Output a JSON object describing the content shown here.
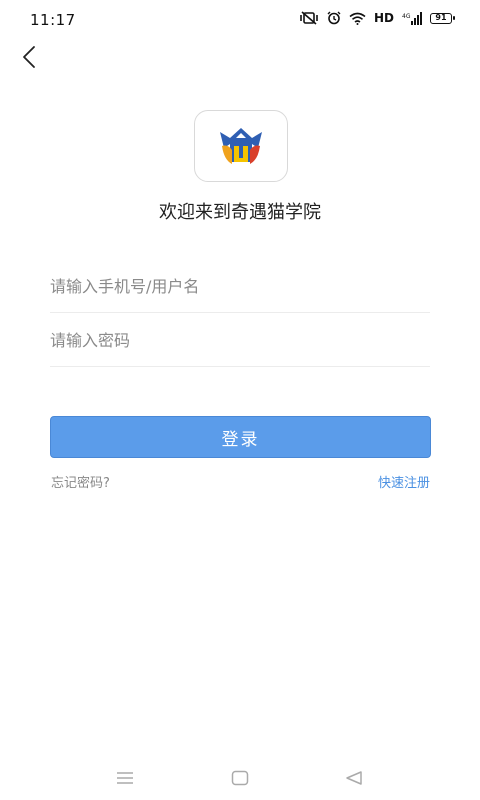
{
  "status_bar": {
    "time": "11:17",
    "network": "HD",
    "battery": "91"
  },
  "header": {
    "back_icon": "chevron-left-icon"
  },
  "logo": {
    "icon": "owl-logo-icon",
    "colors": {
      "blue": "#2f5fb3",
      "orange": "#f0a21c",
      "red": "#d9402b"
    }
  },
  "welcome_text": "欢迎来到奇遇猫学院",
  "form": {
    "username_placeholder": "请输入手机号/用户名",
    "password_placeholder": "请输入密码",
    "login_label": "登录",
    "forgot_label": "忘记密码?",
    "register_label": "快速注册"
  },
  "colors": {
    "accent": "#5b9cea",
    "link": "#4a90e2"
  },
  "nav_bar": {
    "menu_icon": "menu-icon",
    "home_icon": "home-icon",
    "back_icon": "back-triangle-icon"
  }
}
